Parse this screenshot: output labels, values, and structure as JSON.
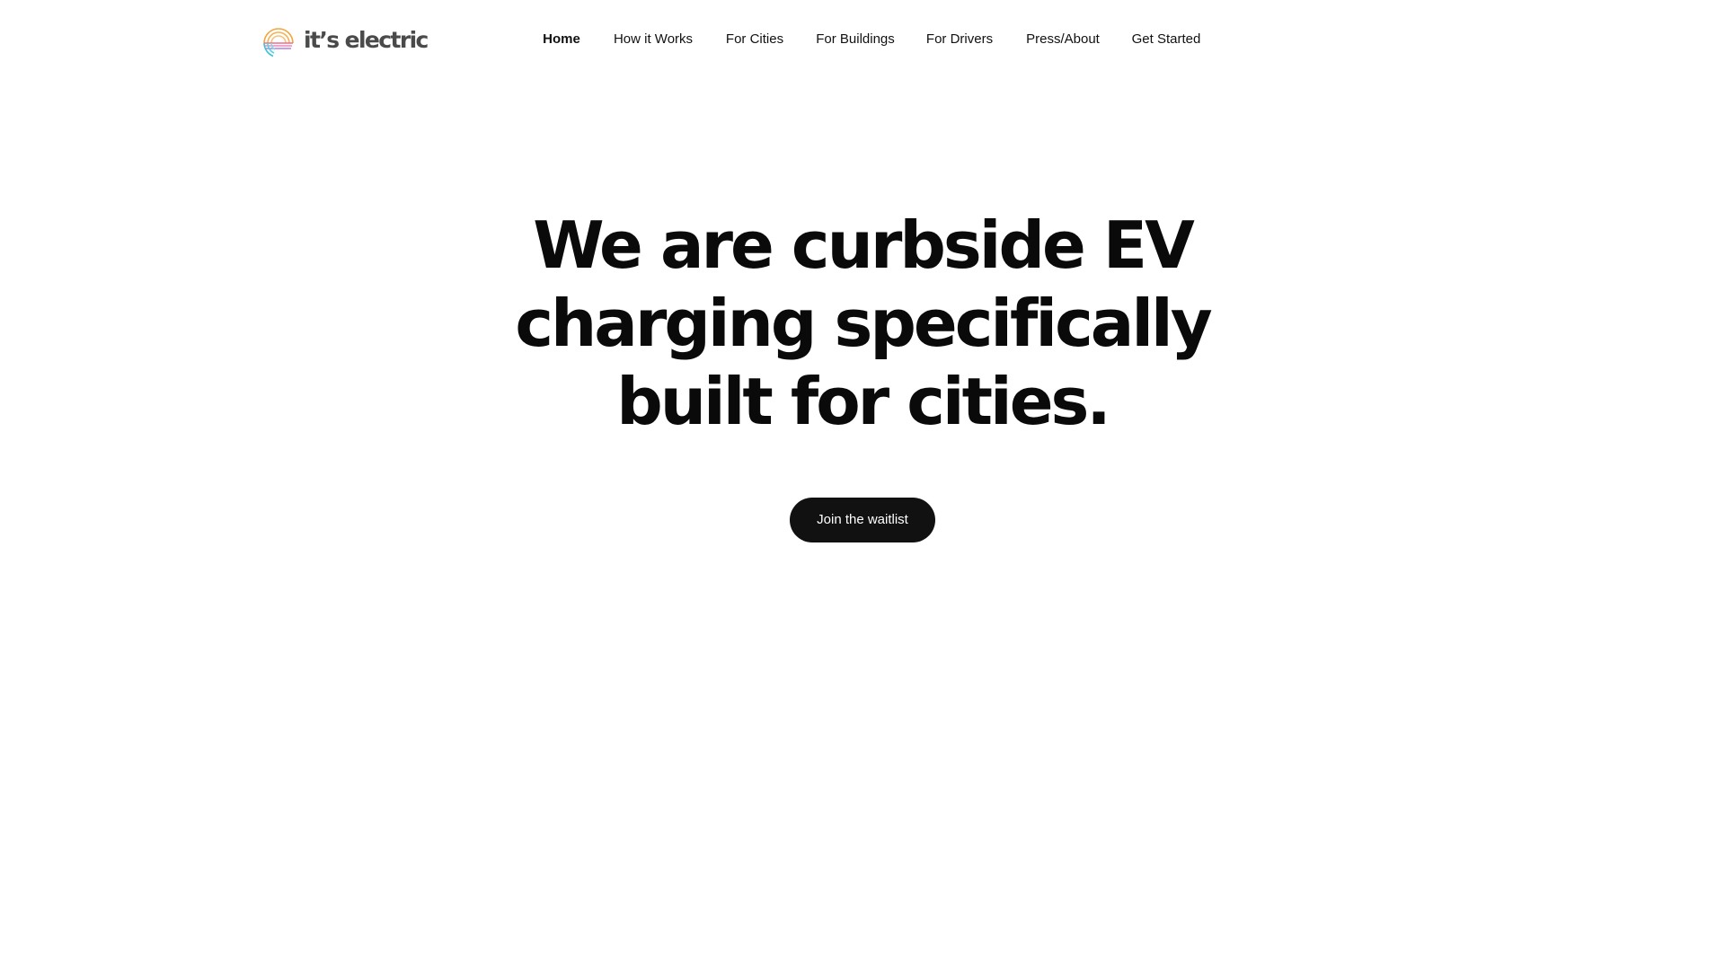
{
  "brand": {
    "logo_text": "it’s electric",
    "logo_colors": [
      "#f2a53a",
      "#ee6d8a",
      "#b77ed8",
      "#3cc2d8"
    ]
  },
  "nav": {
    "items": [
      {
        "label": "Home",
        "active": true
      },
      {
        "label": "How it Works",
        "active": false
      },
      {
        "label": "For Cities",
        "active": false
      },
      {
        "label": "For Buildings",
        "active": false
      },
      {
        "label": "For Drivers",
        "active": false
      },
      {
        "label": "Press/About",
        "active": false
      },
      {
        "label": "Get Started",
        "active": false
      }
    ]
  },
  "hero": {
    "title_line1": "We are curbside EV",
    "title_line2": "charging specifically",
    "title_line3": "built for cities.",
    "cta_label": "Join the waitlist"
  },
  "colors": {
    "background": "#ffffff",
    "text": "#111111",
    "button": "#111111",
    "button_text": "#ffffff"
  }
}
